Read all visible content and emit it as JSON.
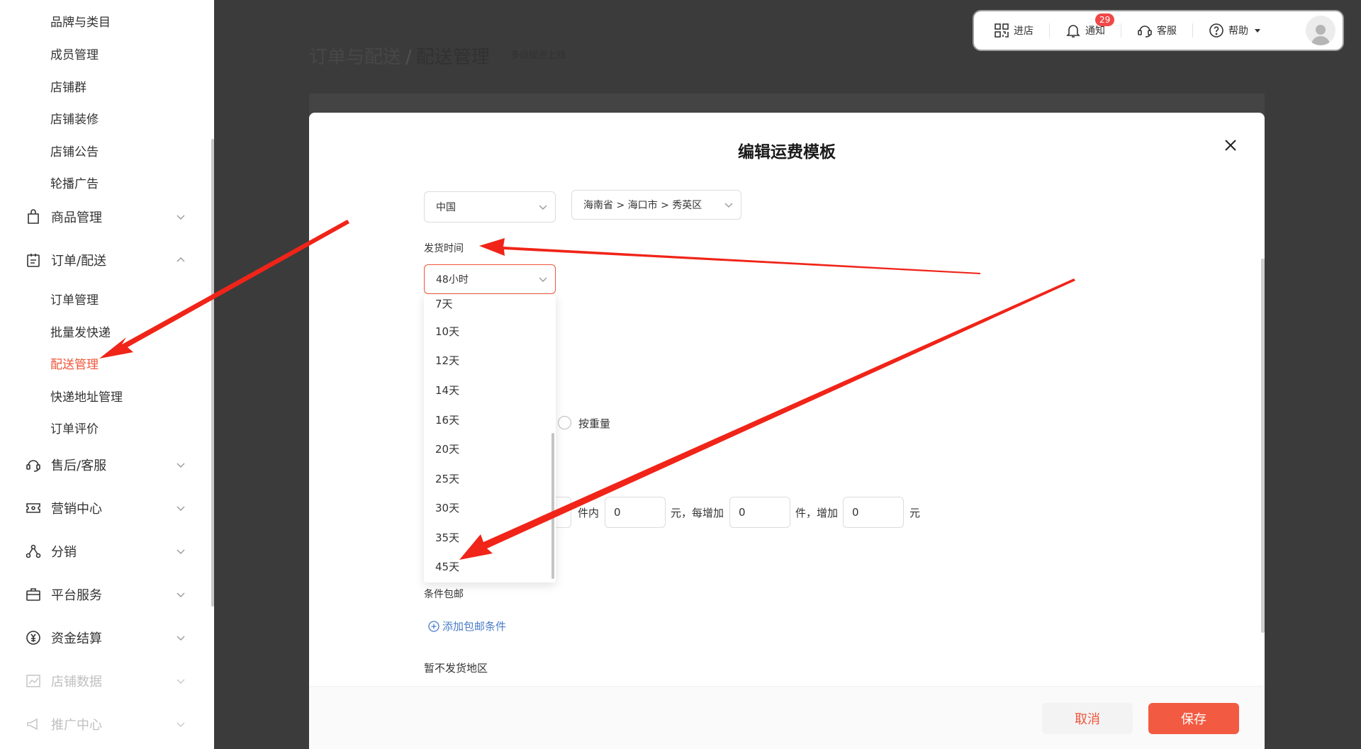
{
  "sidebar": {
    "sub_items_top": [
      "品牌与类目",
      "成员管理",
      "店铺群",
      "店铺装修",
      "店铺公告",
      "轮播广告"
    ],
    "groups": {
      "goods": "商品管理",
      "orders": "订单/配送",
      "after_sales": "售后/客服",
      "marketing": "营销中心",
      "distribution": "分销",
      "platform": "平台服务",
      "finance": "资金结算",
      "data": "店铺数据",
      "promotion": "推广中心"
    },
    "order_sub_items": [
      "订单管理",
      "批量发快递",
      "配送管理",
      "快递地址管理",
      "订单评价"
    ],
    "active_item": "配送管理"
  },
  "page": {
    "breadcrumb_parent": "订单与配送",
    "breadcrumb_sep": "/",
    "breadcrumb_current": "配送管理",
    "note": "多自提点上线"
  },
  "topbar": {
    "store": "进店",
    "notify": "通知",
    "notify_count": "29",
    "service": "客服",
    "help": "帮助"
  },
  "modal": {
    "title": "编辑运费模板",
    "country": "中国",
    "region": "海南省 > 海口市 > 秀英区",
    "ship_time_label": "发货时间",
    "ship_time_value": "48小时",
    "ship_time_options": [
      "7天",
      "10天",
      "12天",
      "14天",
      "16天",
      "20天",
      "25天",
      "30天",
      "35天",
      "45天"
    ],
    "by_weight": "按重量",
    "fee_row": {
      "t1": "件内",
      "v1": "0",
      "t2": "元，每增加",
      "v2": "0",
      "t3": "件，增加",
      "v3": "0",
      "t4": "元"
    },
    "free_ship_label": "条件包邮",
    "add_free_ship": "添加包邮条件",
    "no_ship_label": "暂不发货地区",
    "cancel": "取消",
    "save": "保存"
  },
  "colors": {
    "accent": "#f25b41",
    "active_text": "#f0553a",
    "link": "#4a7cc9",
    "overlay": "#3b3b3b",
    "annotation_arrow": "#f02418"
  }
}
